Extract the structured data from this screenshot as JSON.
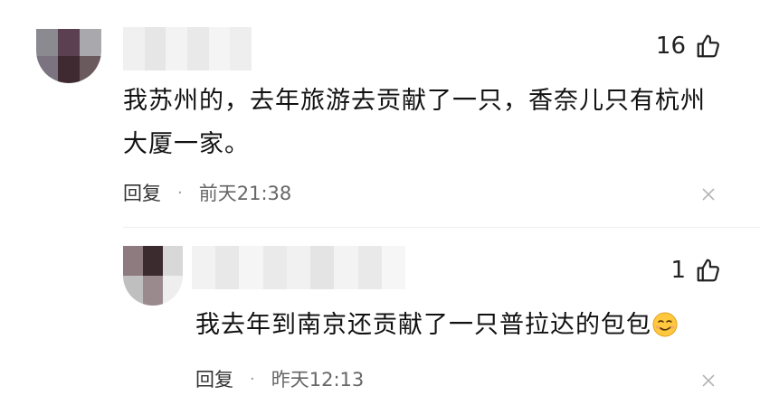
{
  "comments": [
    {
      "likes": "16",
      "text": "我苏州的，去年旅游去贡献了一只，香奈儿只有杭州大厦一家。",
      "reply_label": "回复",
      "separator": "·",
      "time": "前天21:38"
    },
    {
      "likes": "1",
      "text": "我去年到南京还贡献了一只普拉达的包包",
      "emoji": "smirk-emoji",
      "reply_label": "回复",
      "separator": "·",
      "time": "昨天12:13"
    }
  ],
  "icons": {
    "like": "thumbs-up-icon",
    "close": "close-icon"
  },
  "colors": {
    "text": "#111111",
    "meta": "#666666",
    "icon": "#222222"
  }
}
